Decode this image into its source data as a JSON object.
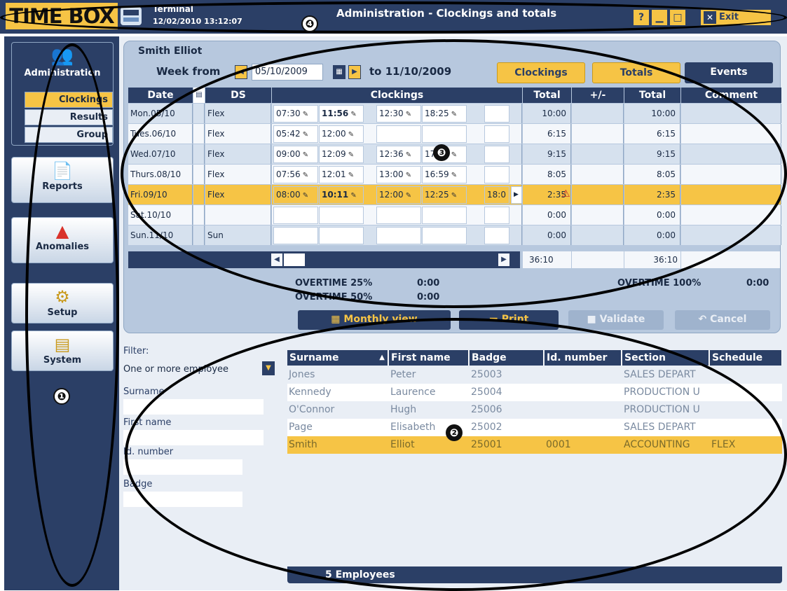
{
  "titlebar": {
    "logo": "TIME BOX",
    "terminal_label": "Terminal",
    "datetime": "12/02/2010 13:12:07",
    "window_title": "Administration - Clockings and totals",
    "help": "?",
    "exit_label": "Exit"
  },
  "callouts": {
    "one": "❶",
    "two": "❷",
    "three": "❸",
    "four": "❹"
  },
  "sidebar": {
    "administration": "Administration",
    "clockings": "Clockings",
    "results": "Results",
    "group": "Group",
    "reports": "Reports",
    "anomalies": "Anomalies",
    "setup": "Setup",
    "system": "System"
  },
  "week": {
    "employee": "Smith Elliot",
    "week_from": "Week from",
    "date_from": "05/10/2009",
    "to": "to 11/10/2009",
    "tabs": {
      "clockings": "Clockings",
      "totals": "Totals",
      "events": "Events"
    },
    "headers": {
      "date": "Date",
      "ds": "DS",
      "clockings": "Clockings",
      "total": "Total",
      "plusminus": "+/-",
      "total2": "Total",
      "comment": "Comment"
    },
    "rows": [
      {
        "date": "Mon.05/10",
        "ds": "Flex",
        "c1": "07:30",
        "c2": "11:56",
        "c3": "12:30",
        "c4": "18:25",
        "c5": "",
        "total": "10:00",
        "pm": "",
        "total2": "10:00"
      },
      {
        "date": "Tues.06/10",
        "ds": "Flex",
        "c1": "05:42",
        "c2": "12:00",
        "c3": "",
        "c4": "",
        "c5": "",
        "total": "6:15",
        "pm": "",
        "total2": "6:15"
      },
      {
        "date": "Wed.07/10",
        "ds": "Flex",
        "c1": "09:00",
        "c2": "12:09",
        "c3": "12:36",
        "c4": "17:45",
        "c5": "",
        "total": "9:15",
        "pm": "",
        "total2": "9:15"
      },
      {
        "date": "Thurs.08/10",
        "ds": "Flex",
        "c1": "07:56",
        "c2": "12:01",
        "c3": "13:00",
        "c4": "16:59",
        "c5": "",
        "total": "8:05",
        "pm": "",
        "total2": "8:05"
      },
      {
        "date": "Fri.09/10",
        "ds": "Flex",
        "c1": "08:00",
        "c2": "10:11",
        "c3": "12:00",
        "c4": "12:25",
        "c5": "18:0",
        "total": "2:35",
        "pm": "",
        "total2": "2:35"
      },
      {
        "date": "Sat.10/10",
        "ds": "",
        "c1": "",
        "c2": "",
        "c3": "",
        "c4": "",
        "c5": "",
        "total": "0:00",
        "pm": "",
        "total2": "0:00"
      },
      {
        "date": "Sun.11/10",
        "ds": "Sun",
        "c1": "",
        "c2": "",
        "c3": "",
        "c4": "",
        "c5": "",
        "total": "0:00",
        "pm": "",
        "total2": "0:00"
      }
    ],
    "sum_total": "36:10",
    "sum_total2": "36:10",
    "ot25_label": "OVERTIME 25%",
    "ot25": "0:00",
    "ot50_label": "OVERTIME 50%",
    "ot50": "0:00",
    "ot100_label": "OVERTIME 100%",
    "ot100": "0:00",
    "buttons": {
      "monthly": "Monthly view",
      "print": "Print",
      "validate": "Validate",
      "cancel": "Cancel"
    }
  },
  "filter": {
    "label": "Filter:",
    "mode": "One or more employee",
    "surname": "Surname",
    "first_name": "First name",
    "id_number": "Id. number",
    "badge": "Badge"
  },
  "employees": {
    "headers": {
      "surname": "Surname",
      "first_name": "First name",
      "badge": "Badge",
      "id_number": "Id. number",
      "section": "Section",
      "schedule": "Schedule"
    },
    "rows": [
      {
        "surname": "Jones",
        "first_name": "Peter",
        "badge": "25003",
        "id": "",
        "section": "SALES DEPART",
        "schedule": ""
      },
      {
        "surname": "Kennedy",
        "first_name": "Laurence",
        "badge": "25004",
        "id": "",
        "section": "PRODUCTION U",
        "schedule": ""
      },
      {
        "surname": "O'Connor",
        "first_name": "Hugh",
        "badge": "25006",
        "id": "",
        "section": "PRODUCTION U",
        "schedule": ""
      },
      {
        "surname": "Page",
        "first_name": "Elisabeth",
        "badge": "25002",
        "id": "",
        "section": "SALES DEPART",
        "schedule": ""
      },
      {
        "surname": "Smith",
        "first_name": "Elliot",
        "badge": "25001",
        "id": "0001",
        "section": "ACCOUNTING",
        "schedule": "FLEX"
      }
    ],
    "count_label": "5 Employees"
  }
}
